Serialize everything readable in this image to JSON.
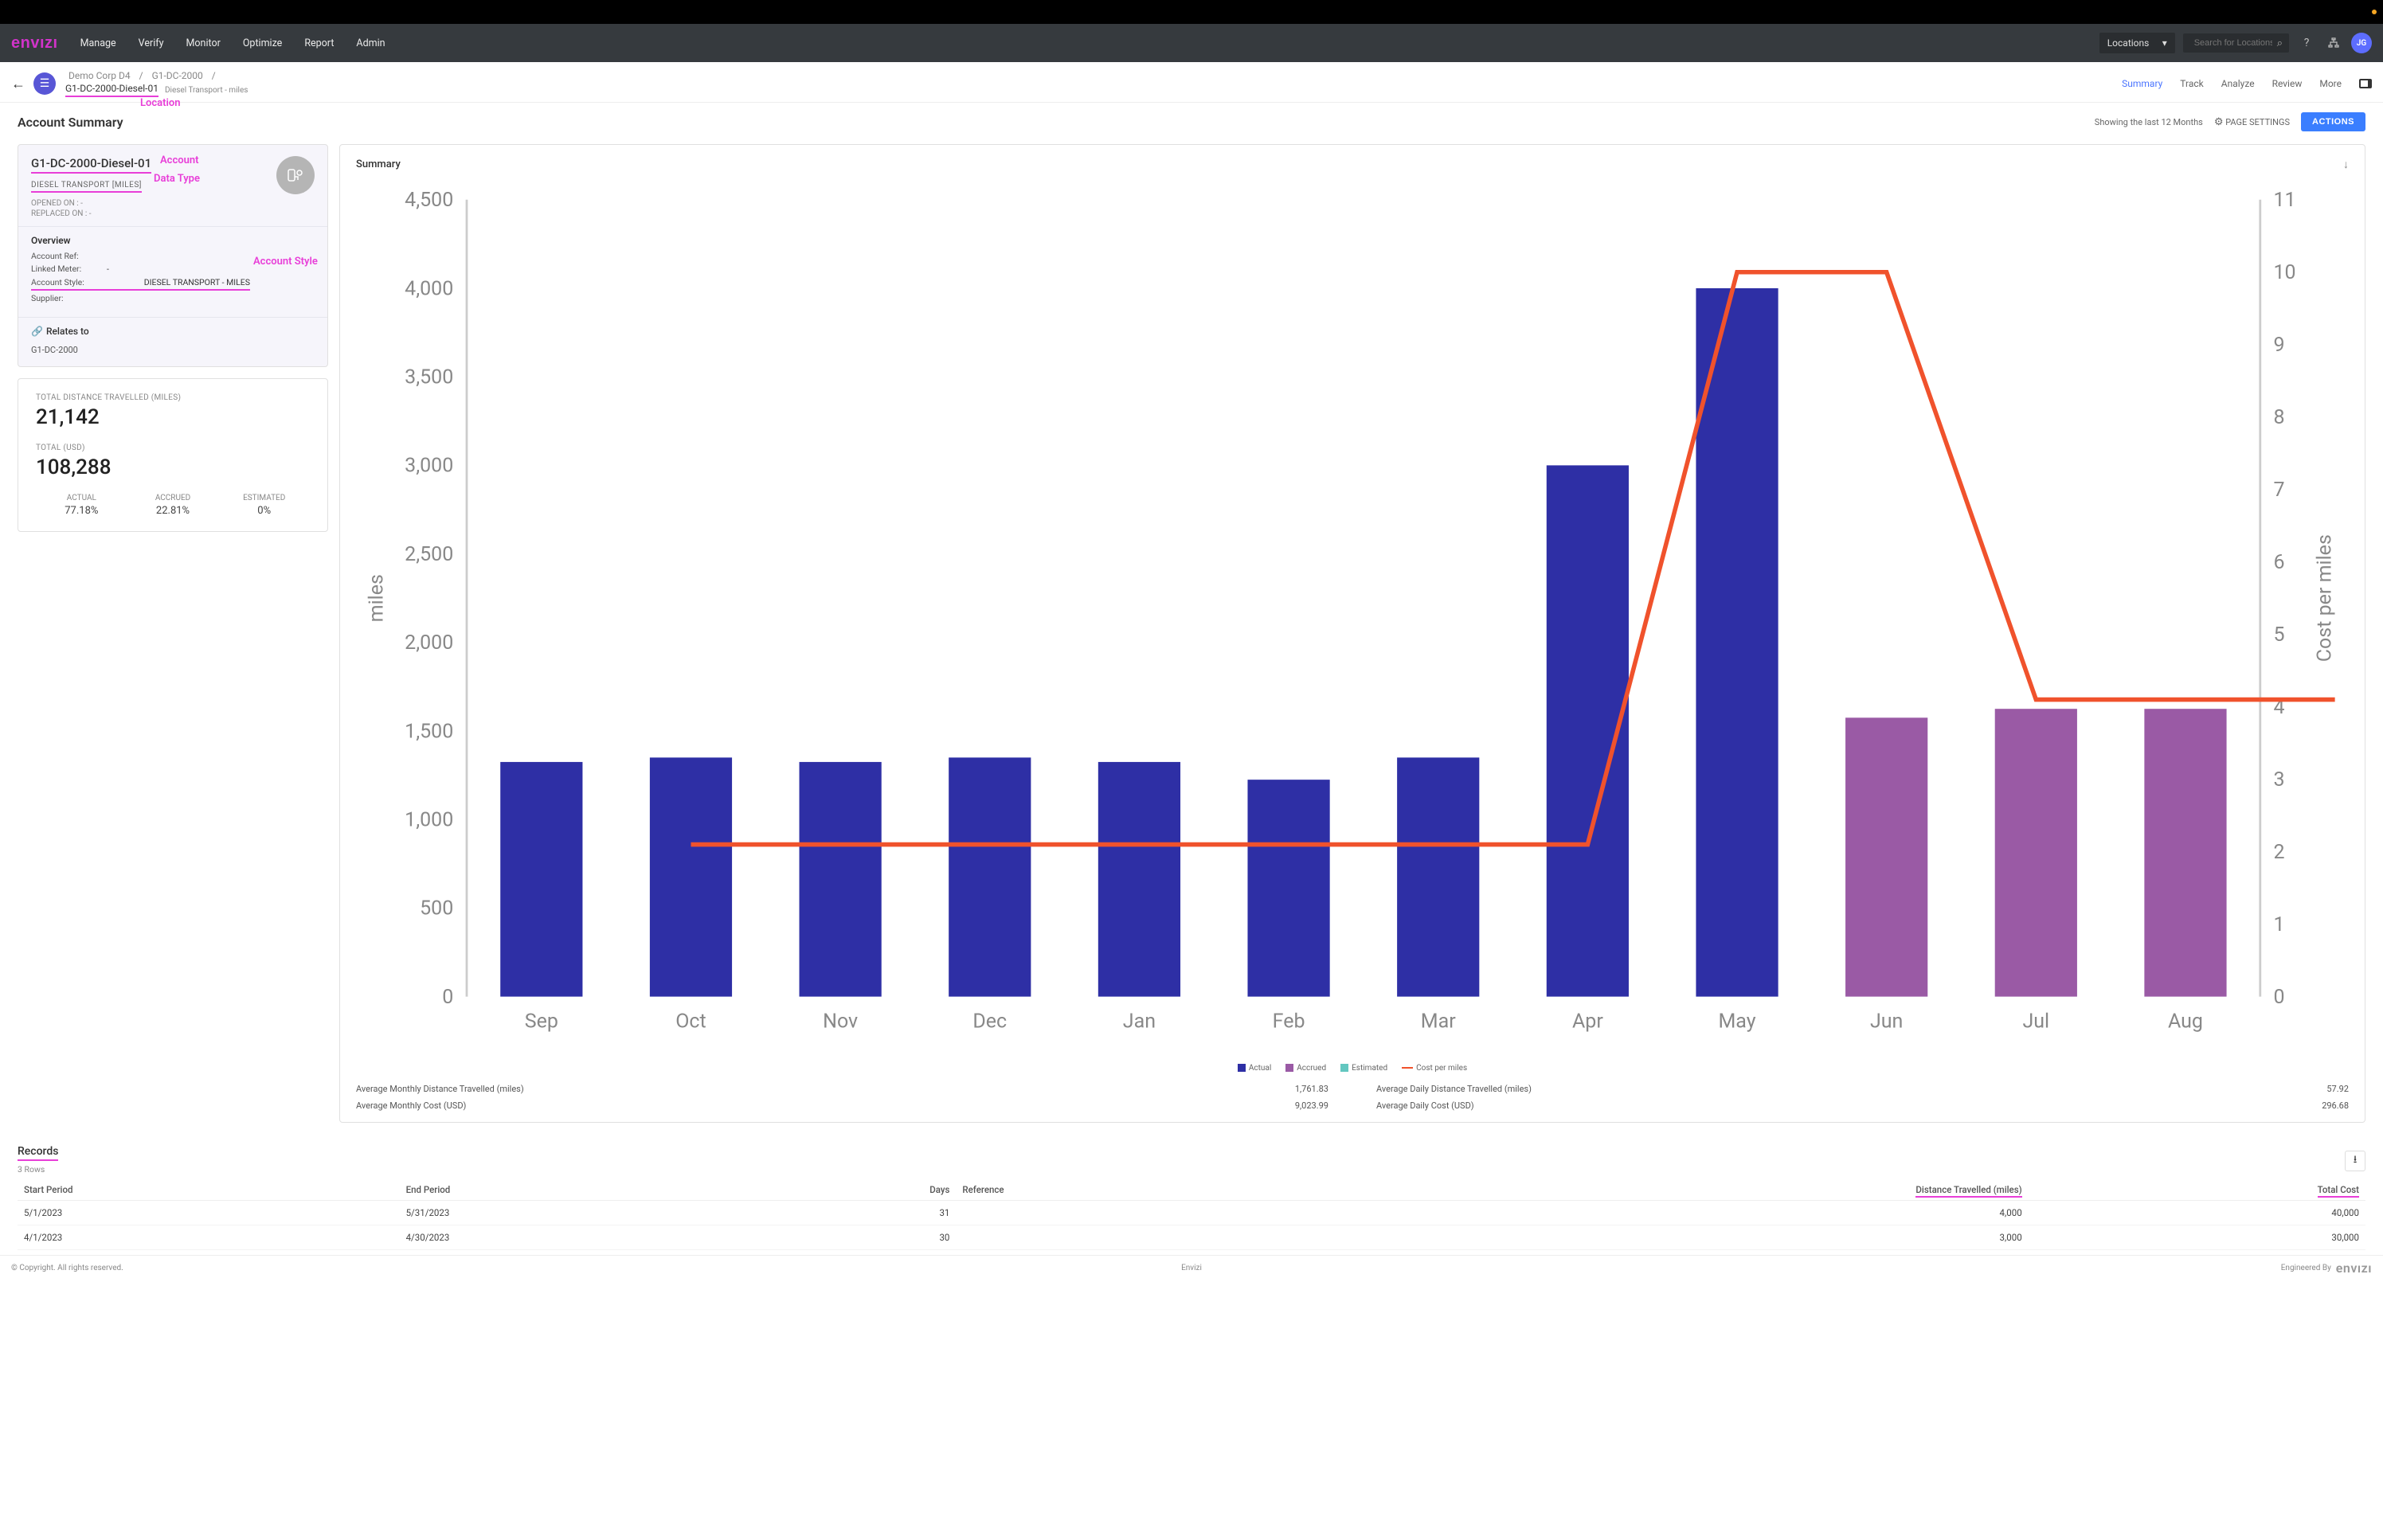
{
  "nav": {
    "logo": "envızı",
    "links": [
      "Manage",
      "Verify",
      "Monitor",
      "Optimize",
      "Report",
      "Admin"
    ],
    "loc_select_label": "Locations",
    "search_placeholder": "Search for Locations",
    "avatar_initials": "JG"
  },
  "breadcrumbs": {
    "items": [
      "Demo Corp D4",
      "G1-DC-2000"
    ],
    "active": "G1-DC-2000-Diesel-01",
    "sub": "Diesel Transport - miles"
  },
  "subnav": {
    "items": [
      "Summary",
      "Track",
      "Analyze",
      "Review",
      "More"
    ],
    "active_index": 0
  },
  "annotations": {
    "location": "Location",
    "account": "Account",
    "data_type": "Data Type",
    "account_style": "Account Style"
  },
  "page_title": "Account Summary",
  "page_settings": {
    "showing": "Showing the last 12 Months",
    "page_settings_label": "PAGE SETTINGS",
    "actions_label": "ACTIONS"
  },
  "account": {
    "name": "G1-DC-2000-Diesel-01",
    "data_type": "DIESEL TRANSPORT [MILES]",
    "opened_on_label": "OPENED ON :",
    "opened_on_value": "-",
    "replaced_on_label": "REPLACED ON :",
    "replaced_on_value": "-",
    "overview_title": "Overview",
    "kv": [
      {
        "k": "Account Ref:",
        "v": ""
      },
      {
        "k": "Linked Meter:",
        "v": "-"
      },
      {
        "k": "Account Style:",
        "v": "DIESEL TRANSPORT - MILES"
      },
      {
        "k": "Supplier:",
        "v": ""
      }
    ],
    "relates_title": "Relates to",
    "relates_item": "G1-DC-2000"
  },
  "metrics": {
    "distance_label": "TOTAL DISTANCE TRAVELLED (MILES)",
    "distance_value": "21,142",
    "cost_label": "TOTAL (USD)",
    "cost_value": "108,288",
    "pcts": [
      {
        "label": "ACTUAL",
        "value": "77.18%"
      },
      {
        "label": "ACCRUED",
        "value": "22.81%"
      },
      {
        "label": "ESTIMATED",
        "value": "0%"
      }
    ]
  },
  "chart": {
    "title": "Summary",
    "legend": {
      "actual": "Actual",
      "accrued": "Accrued",
      "estimated": "Estimated",
      "cost": "Cost per miles"
    },
    "avg_metrics": [
      {
        "label": "Average Monthly Distance Travelled (miles)",
        "value": "1,761.83"
      },
      {
        "label": "Average Daily Distance Travelled (miles)",
        "value": "57.92"
      },
      {
        "label": "Average Monthly Cost (USD)",
        "value": "9,023.99"
      },
      {
        "label": "Average Daily Cost (USD)",
        "value": "296.68"
      }
    ]
  },
  "chart_data": {
    "type": "bar+line",
    "categories": [
      "Sep",
      "Oct",
      "Nov",
      "Dec",
      "Jan",
      "Feb",
      "Mar",
      "Apr",
      "May",
      "Jun",
      "Jul",
      "Aug"
    ],
    "ylabel_left": "miles",
    "ylabel_right": "Cost per miles",
    "ylim_left": [
      0,
      4500
    ],
    "ylim_right": [
      0,
      11
    ],
    "yticks_left": [
      0,
      500,
      1000,
      1500,
      2000,
      2500,
      3000,
      3500,
      4000,
      4500
    ],
    "yticks_right": [
      0,
      1,
      2,
      3,
      4,
      5,
      6,
      7,
      8,
      9,
      10,
      11
    ],
    "series": [
      {
        "name": "Actual",
        "type": "bar",
        "color": "#2e2fa5",
        "values": [
          1325,
          1350,
          1325,
          1350,
          1325,
          1225,
          1350,
          3000,
          4000,
          null,
          null,
          null
        ]
      },
      {
        "name": "Accrued",
        "type": "bar",
        "color": "#9a5aa5",
        "values": [
          null,
          null,
          null,
          null,
          null,
          null,
          null,
          null,
          null,
          1575,
          1625,
          1625
        ]
      },
      {
        "name": "Estimated",
        "type": "bar",
        "color": "#63c7c0",
        "values": [
          null,
          null,
          null,
          null,
          null,
          null,
          null,
          null,
          null,
          null,
          null,
          null
        ]
      },
      {
        "name": "Cost per miles",
        "type": "line",
        "color": "#f0522c",
        "values": [
          null,
          2.1,
          2.1,
          2.1,
          2.1,
          2.1,
          2.1,
          2.1,
          10,
          10,
          4.1,
          4.1,
          4.1
        ]
      }
    ]
  },
  "records": {
    "title": "Records",
    "count_text": "3 Rows",
    "columns": [
      "Start Period",
      "End Period",
      "Days",
      "Reference",
      "Distance Travelled (miles)",
      "Total Cost"
    ],
    "rows": [
      {
        "start": "5/1/2023",
        "end": "5/31/2023",
        "days": "31",
        "ref": "",
        "dist": "4,000",
        "cost": "40,000"
      },
      {
        "start": "4/1/2023",
        "end": "4/30/2023",
        "days": "30",
        "ref": "",
        "dist": "3,000",
        "cost": "30,000"
      }
    ]
  },
  "footer": {
    "copyright": "© Copyright. All rights reserved.",
    "center": "Envizi",
    "eng_label": "Engineered By",
    "eng_logo": "envızı"
  },
  "colors": {
    "actual": "#2e2fa5",
    "accrued": "#9a5aa5",
    "estimated": "#63c7c0",
    "line": "#f0522c",
    "accent": "#e83ed8"
  }
}
